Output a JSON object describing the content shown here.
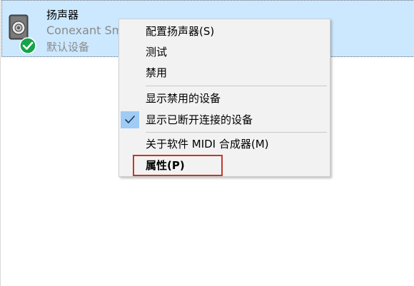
{
  "device": {
    "name": "扬声器",
    "description": "Conexant Sm",
    "status": "默认设备",
    "icon": "speaker-icon",
    "status_icon": "default-check-badge-icon"
  },
  "context_menu": {
    "items": [
      {
        "label": "配置扬声器(S)"
      },
      {
        "label": "测试"
      },
      {
        "label": "禁用"
      },
      {
        "label": "显示禁用的设备"
      },
      {
        "label": "显示已断开连接的设备",
        "checked": true
      },
      {
        "label": "关于软件 MIDI 合成器(M)"
      },
      {
        "label": "属性(P)",
        "bold": true,
        "highlighted_annotation": true
      }
    ],
    "check_icon": "checkmark-icon"
  },
  "colors": {
    "selection_bg": "#cce8ff",
    "menu_bg": "#f2f2f2",
    "check_bg": "#9fcbf5",
    "annotation_red": "#c0392b",
    "badge_green": "#16a34a"
  }
}
